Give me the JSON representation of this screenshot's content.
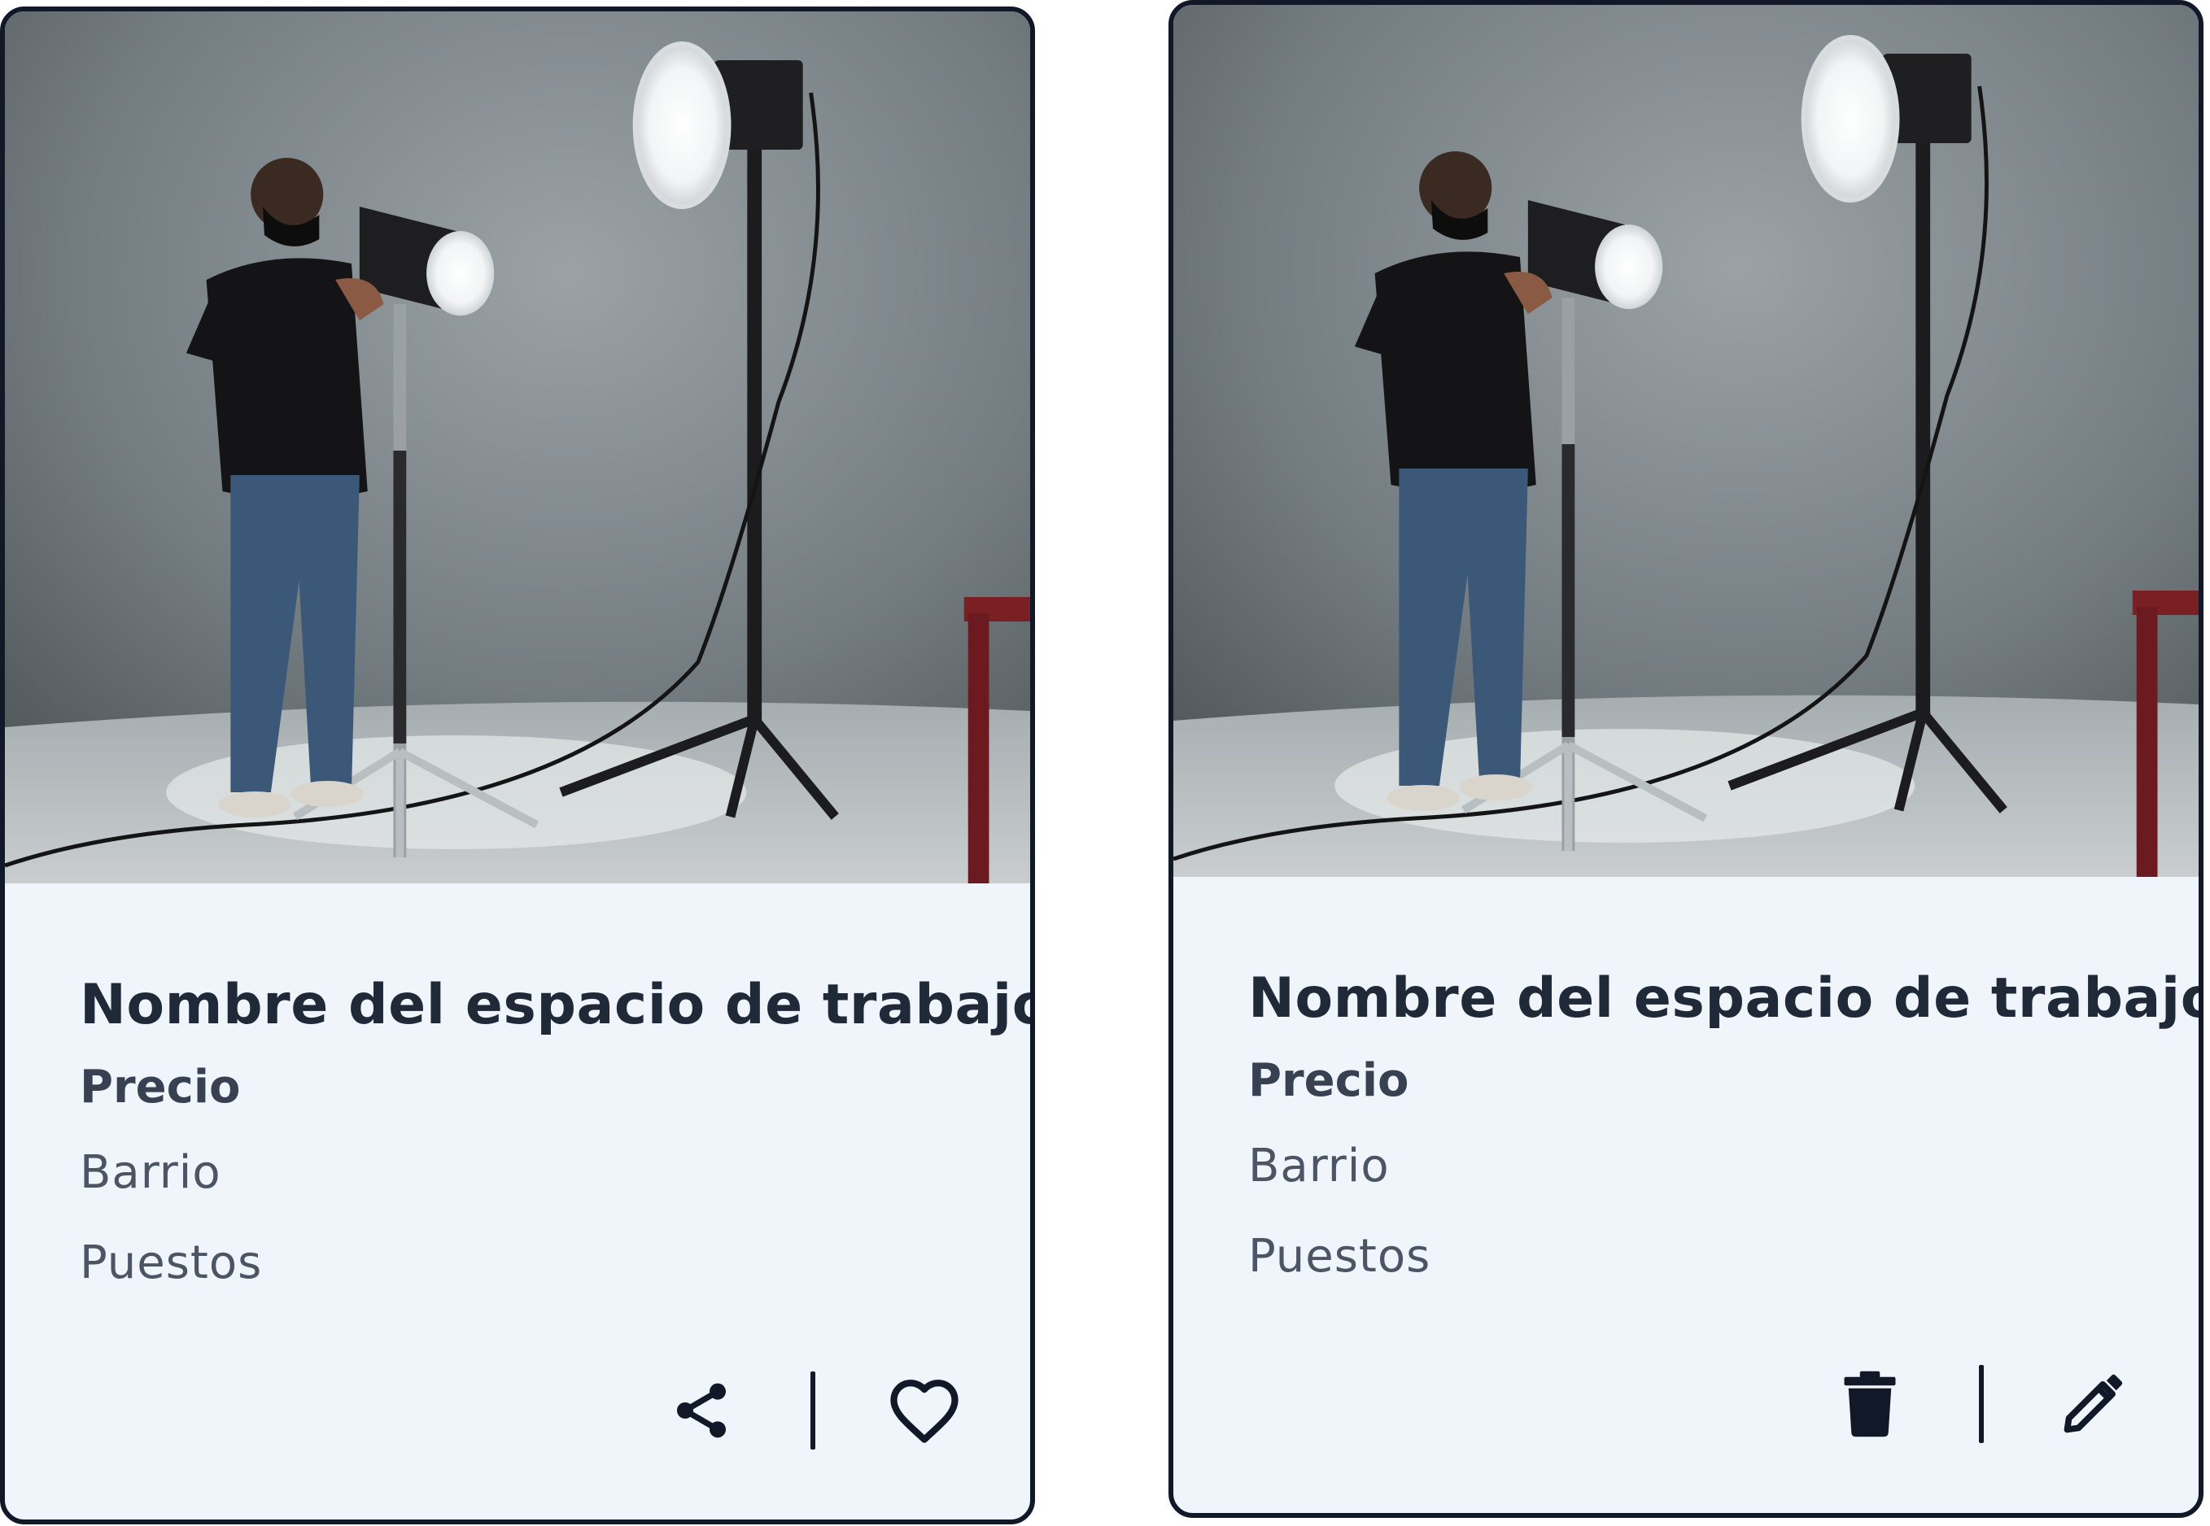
{
  "cards": [
    {
      "title": "Nombre del espacio de trabajo",
      "price_label": "Precio",
      "neighborhood_label": "Barrio",
      "seats_label": "Puestos",
      "actions": [
        "share-icon",
        "heart-icon"
      ]
    },
    {
      "title": "Nombre del espacio de trabajo",
      "price_label": "Precio",
      "neighborhood_label": "Barrio",
      "seats_label": "Puestos",
      "actions": [
        "trash-icon",
        "pencil-icon"
      ]
    }
  ],
  "colors": {
    "card_background": "#f0f5fc",
    "border": "#111827",
    "title": "#1f2937",
    "icon": "#111827"
  }
}
